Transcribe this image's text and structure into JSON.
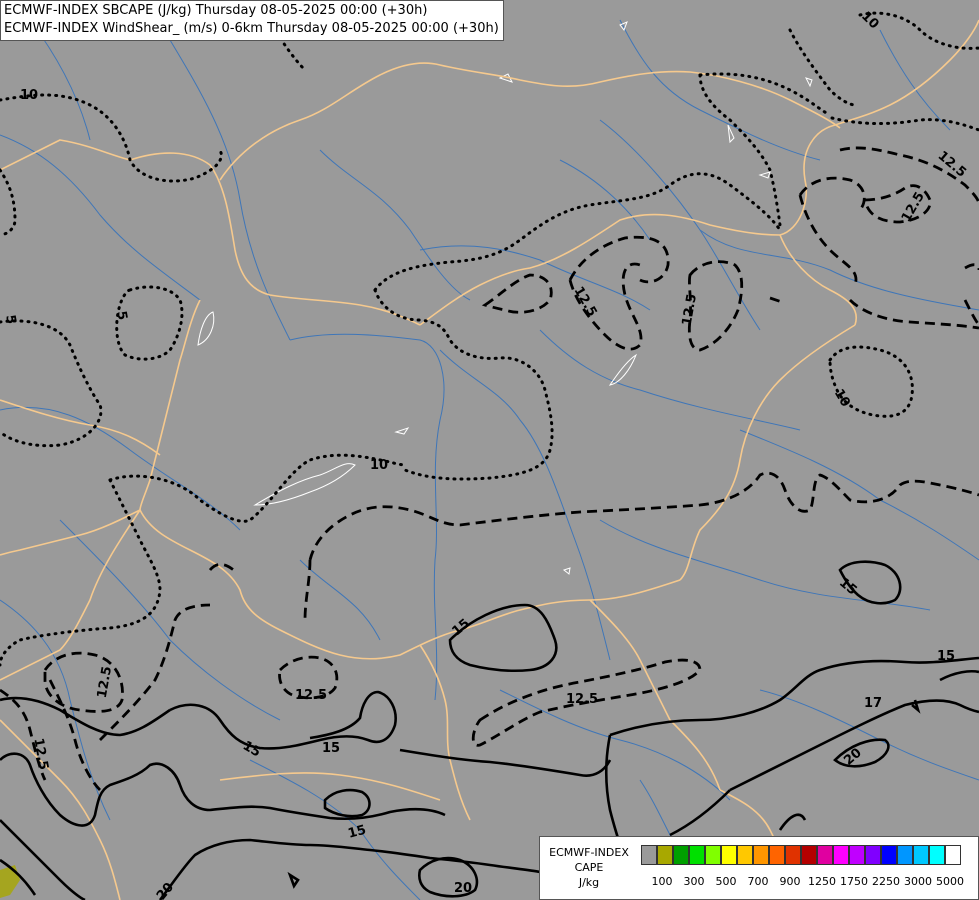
{
  "header": {
    "line1": "ECMWF-INDEX SBCAPE (J/kg) Thursday 08-05-2025 00:00 (+30h)",
    "line2": "ECMWF-INDEX WindShear_ (m/s) 0-6km Thursday 08-05-2025 00:00 (+30h)"
  },
  "legend": {
    "title1": "ECMWF-INDEX",
    "title2": "CAPE",
    "units": "J/kg",
    "colors": [
      "#9a9a9a",
      "#a8a800",
      "#00a000",
      "#00e000",
      "#80ff00",
      "#ffff00",
      "#ffc800",
      "#ff9600",
      "#ff6400",
      "#e03200",
      "#b40000",
      "#e000a0",
      "#ff00ff",
      "#c000ff",
      "#8000ff",
      "#0000ff",
      "#0096ff",
      "#00c8ff",
      "#00ffff",
      "#ffffff"
    ],
    "ticks": [
      "100",
      "300",
      "500",
      "700",
      "900",
      "1250",
      "1750",
      "2250",
      "3000",
      "5000"
    ]
  },
  "contour_labels": [
    {
      "text": "10",
      "value": 10
    },
    {
      "text": "10",
      "value": 10
    },
    {
      "text": "10",
      "value": 10
    },
    {
      "text": "10",
      "value": 10
    },
    {
      "text": "5",
      "value": 5
    },
    {
      "text": "5",
      "value": 5
    },
    {
      "text": "12.5",
      "value": 12.5
    },
    {
      "text": "12.5",
      "value": 12.5
    },
    {
      "text": "12.5",
      "value": 12.5
    },
    {
      "text": "12.5",
      "value": 12.5
    },
    {
      "text": "12.5",
      "value": 12.5
    },
    {
      "text": "12.5",
      "value": 12.5
    },
    {
      "text": "12.5",
      "value": 12.5
    },
    {
      "text": "12.5",
      "value": 12.5
    },
    {
      "text": "15",
      "value": 15
    },
    {
      "text": "15",
      "value": 15
    },
    {
      "text": "15",
      "value": 15
    },
    {
      "text": "15",
      "value": 15
    },
    {
      "text": "15",
      "value": 15
    },
    {
      "text": "15",
      "value": 15
    },
    {
      "text": "17",
      "value": 17
    },
    {
      "text": "20",
      "value": 20
    },
    {
      "text": "20",
      "value": 20
    },
    {
      "text": "20",
      "value": 20
    }
  ]
}
